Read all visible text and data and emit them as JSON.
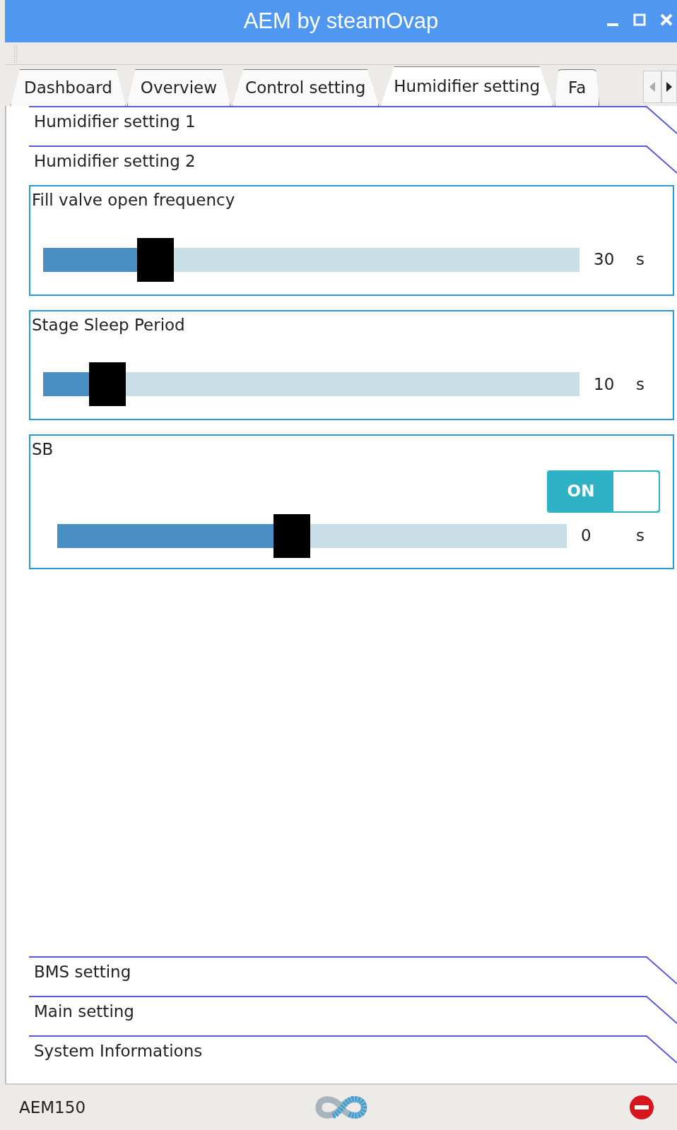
{
  "window": {
    "title": "AEM by steamOvap"
  },
  "tabs": [
    {
      "label": "Dashboard",
      "selected": false
    },
    {
      "label": "Overview",
      "selected": false
    },
    {
      "label": "Control setting",
      "selected": false
    },
    {
      "label": "Humidifier setting",
      "selected": true
    },
    {
      "label": "Fa",
      "selected": false
    }
  ],
  "sections_top": [
    {
      "title": "Humidifier setting 1"
    },
    {
      "title": "Humidifier setting 2"
    }
  ],
  "panels": [
    {
      "title": "Fill valve open frequency",
      "level": 0.21,
      "reading": "30",
      "unit": "s"
    },
    {
      "title": "Stage Sleep Period",
      "level": 0.12,
      "reading": "10",
      "unit": "s"
    },
    {
      "title": "SB",
      "level": 0.46,
      "reading": "0",
      "unit": "s",
      "switch": {
        "label": "ON",
        "on": true
      }
    }
  ],
  "sections_bottom": [
    {
      "title": "BMS setting"
    },
    {
      "title": "Main setting"
    },
    {
      "title": "System Informations"
    }
  ],
  "status_bar": {
    "device": "AEM150"
  }
}
